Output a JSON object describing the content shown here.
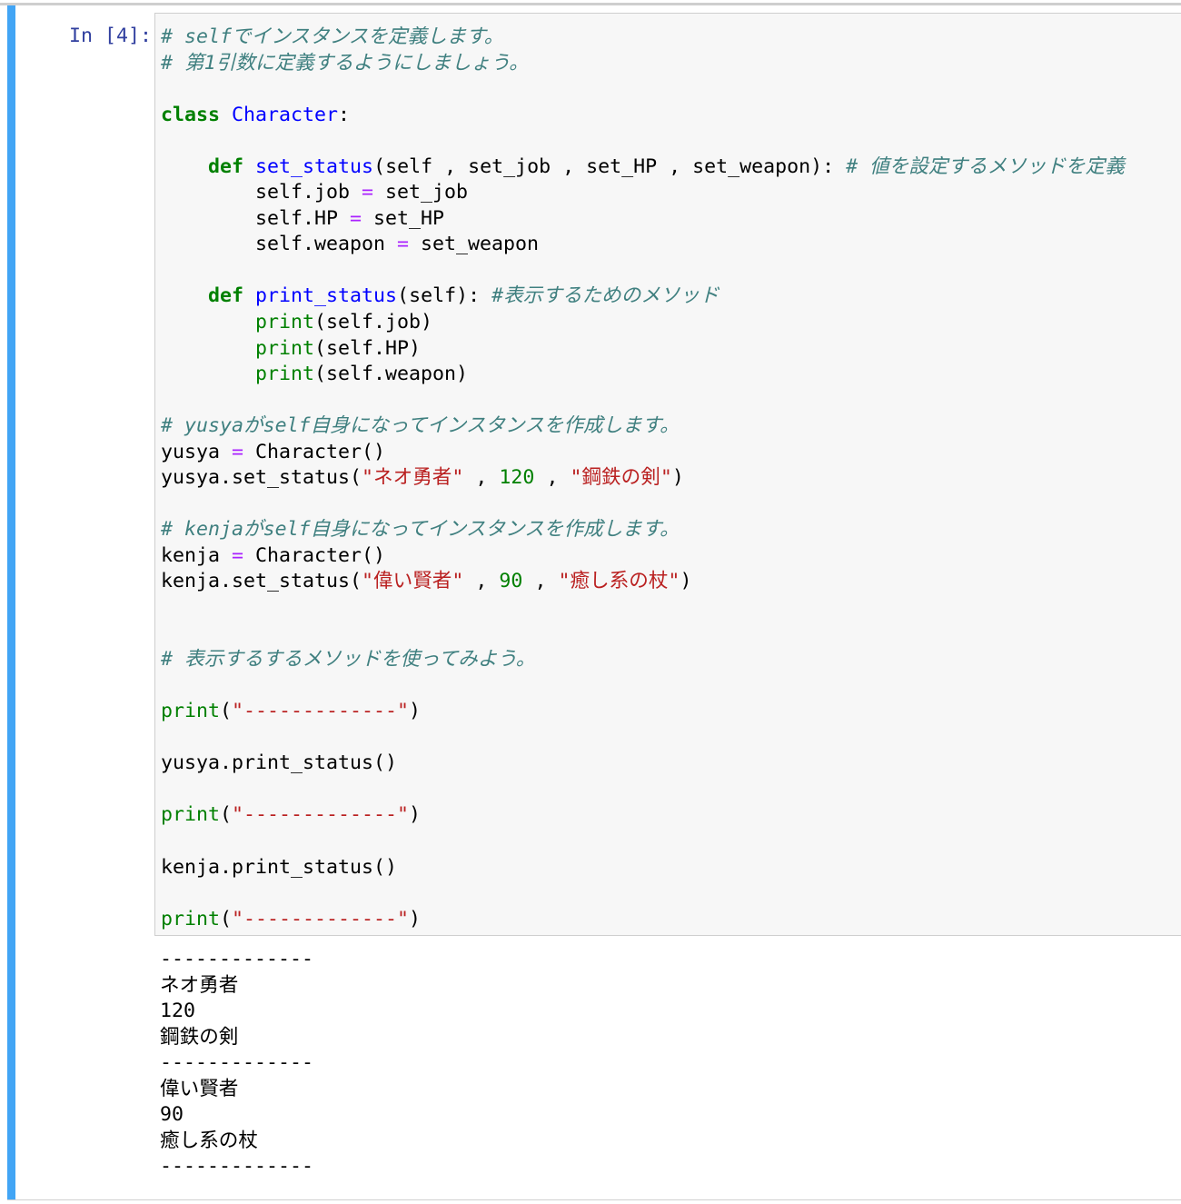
{
  "cell": {
    "prompt": "In [4]:",
    "code_lines": [
      [
        [
          "# selfでインスタンスを定義します。",
          "c"
        ]
      ],
      [
        [
          "# 第1引数に定義するようにしましょう。",
          "c"
        ]
      ],
      [],
      [
        [
          "class",
          "k"
        ],
        [
          " ",
          ""
        ],
        [
          "Character",
          "nc"
        ],
        [
          ":",
          ""
        ]
      ],
      [],
      [
        [
          "    ",
          ""
        ],
        [
          "def",
          "k"
        ],
        [
          " ",
          ""
        ],
        [
          "set_status",
          "nf"
        ],
        [
          "(self , set_job , set_HP , set_weapon): ",
          ""
        ],
        [
          "# 値を設定するメソッドを定義",
          "c"
        ]
      ],
      [
        [
          "        self.job ",
          ""
        ],
        [
          "=",
          "o"
        ],
        [
          " set_job",
          ""
        ]
      ],
      [
        [
          "        self.HP ",
          ""
        ],
        [
          "=",
          "o"
        ],
        [
          " set_HP",
          ""
        ]
      ],
      [
        [
          "        self.weapon ",
          ""
        ],
        [
          "=",
          "o"
        ],
        [
          " set_weapon",
          ""
        ]
      ],
      [],
      [
        [
          "    ",
          ""
        ],
        [
          "def",
          "k"
        ],
        [
          " ",
          ""
        ],
        [
          "print_status",
          "nf"
        ],
        [
          "(self): ",
          ""
        ],
        [
          "#表示するためのメソッド",
          "c"
        ]
      ],
      [
        [
          "        ",
          ""
        ],
        [
          "print",
          "b"
        ],
        [
          "(self.job)",
          ""
        ]
      ],
      [
        [
          "        ",
          ""
        ],
        [
          "print",
          "b"
        ],
        [
          "(self.HP)",
          ""
        ]
      ],
      [
        [
          "        ",
          ""
        ],
        [
          "print",
          "b"
        ],
        [
          "(self.weapon)",
          ""
        ]
      ],
      [],
      [
        [
          "# yusyaがself自身になってインスタンスを作成します。",
          "c"
        ]
      ],
      [
        [
          "yusya ",
          ""
        ],
        [
          "=",
          "o"
        ],
        [
          " Character()",
          ""
        ]
      ],
      [
        [
          "yusya.set_status(",
          ""
        ],
        [
          "\"ネオ勇者\"",
          "s"
        ],
        [
          " , ",
          ""
        ],
        [
          "120",
          "m"
        ],
        [
          " , ",
          ""
        ],
        [
          "\"鋼鉄の剣\"",
          "s"
        ],
        [
          ")",
          ""
        ]
      ],
      [],
      [
        [
          "# kenjaがself自身になってインスタンスを作成します。",
          "c"
        ]
      ],
      [
        [
          "kenja ",
          ""
        ],
        [
          "=",
          "o"
        ],
        [
          " Character()",
          ""
        ]
      ],
      [
        [
          "kenja.set_status(",
          ""
        ],
        [
          "\"偉い賢者\"",
          "s"
        ],
        [
          " , ",
          ""
        ],
        [
          "90",
          "m"
        ],
        [
          " , ",
          ""
        ],
        [
          "\"癒し系の杖\"",
          "s"
        ],
        [
          ")",
          ""
        ]
      ],
      [],
      [],
      [
        [
          "# 表示するするメソッドを使ってみよう。",
          "c"
        ]
      ],
      [],
      [
        [
          "print",
          "b"
        ],
        [
          "(",
          ""
        ],
        [
          "\"-------------\"",
          "s"
        ],
        [
          ")",
          ""
        ]
      ],
      [],
      [
        [
          "yusya.print_status()",
          ""
        ]
      ],
      [],
      [
        [
          "print",
          "b"
        ],
        [
          "(",
          ""
        ],
        [
          "\"-------------\"",
          "s"
        ],
        [
          ")",
          ""
        ]
      ],
      [],
      [
        [
          "kenja.print_status()",
          ""
        ]
      ],
      [],
      [
        [
          "print",
          "b"
        ],
        [
          "(",
          ""
        ],
        [
          "\"-------------\"",
          "s"
        ],
        [
          ")",
          ""
        ]
      ]
    ],
    "output_lines": [
      "-------------",
      "ネオ勇者",
      "120",
      "鋼鉄の剣",
      "-------------",
      "偉い賢者",
      "90",
      "癒し系の杖",
      "-------------"
    ]
  },
  "colors": {
    "accent_bar": "#42a5f5",
    "comment": "#408080",
    "keyword": "#008000",
    "string": "#ba2121",
    "operator": "#aa22ff"
  }
}
